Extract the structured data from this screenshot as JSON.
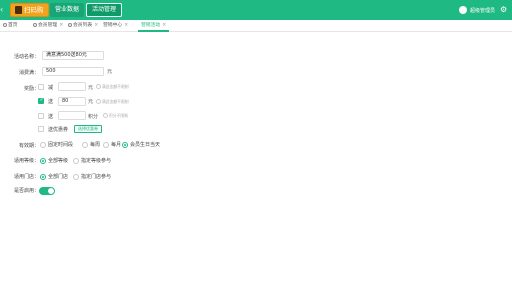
{
  "topbar": {
    "brand_label": "扫码购",
    "nav": [
      "营业数据",
      "活动管理"
    ],
    "user_name": "超级管理员"
  },
  "tabs": [
    {
      "label": "首页",
      "active": false
    },
    {
      "label": "会员管理",
      "active": false
    },
    {
      "label": "会员列表",
      "active": false
    },
    {
      "label": "营销中心",
      "active": false
    },
    {
      "label": "营销活动",
      "active": true
    }
  ],
  "form": {
    "name_label": "活动名称：",
    "name_value": "满意满500送80元",
    "threshold_label": "消费满：",
    "threshold_value": "500",
    "threshold_unit": "元",
    "reward_label": "奖励：",
    "rewards": [
      {
        "name": "减",
        "value": "",
        "unit": "元",
        "hint": "满此金额不限制",
        "checked": false
      },
      {
        "name": "送",
        "value": "80",
        "unit": "元",
        "hint": "满此金额不限制",
        "checked": true
      },
      {
        "name": "送",
        "value": "",
        "unit": "积分",
        "hint": "积分不限制",
        "checked": false
      },
      {
        "name": "送优惠券",
        "button": "选择优惠券",
        "checked": false
      }
    ],
    "validity_label": "有效期：",
    "validity_options": [
      "固定时间段",
      "每周",
      "每月",
      "会员生日当天"
    ],
    "validity_selected": 3,
    "level_label": "适用等级：",
    "level_options": [
      "全部等级",
      "指定等级参与"
    ],
    "level_selected": 0,
    "store_label": "适用门店：",
    "store_options": [
      "全部门店",
      "指定门店参与"
    ],
    "store_selected": 0,
    "enable_label": "是否启用：",
    "enabled": true
  },
  "colors": {
    "accent": "#1fb983",
    "brand": "#f2a21c"
  }
}
